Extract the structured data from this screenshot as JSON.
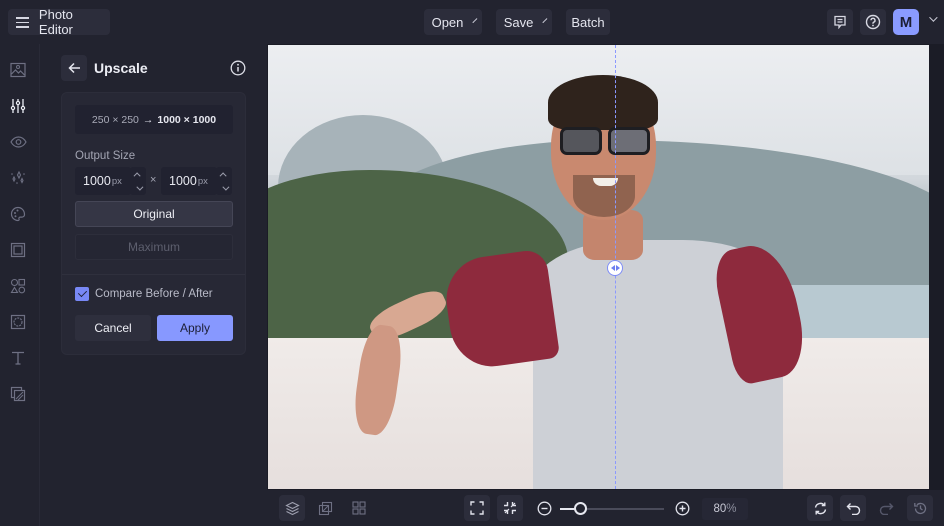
{
  "app": {
    "title": "Photo Editor",
    "menu_icon": "hamburger-icon"
  },
  "topbar": {
    "open_label": "Open",
    "save_label": "Save",
    "batch_label": "Batch",
    "feedback_icon": "comment-icon",
    "help_icon": "help-icon",
    "avatar_initial": "M",
    "accent_color": "#8a9bff"
  },
  "rail": {
    "items": [
      {
        "name": "image",
        "icon": "image-icon",
        "active": false
      },
      {
        "name": "adjust",
        "icon": "sliders-icon",
        "active": true
      },
      {
        "name": "view",
        "icon": "eye-icon",
        "active": false
      },
      {
        "name": "effects",
        "icon": "sparkles-icon",
        "active": false
      },
      {
        "name": "artsy",
        "icon": "palette-icon",
        "active": false
      },
      {
        "name": "frames",
        "icon": "frame-icon",
        "active": false
      },
      {
        "name": "graphics",
        "icon": "shapes-icon",
        "active": false
      },
      {
        "name": "overlays",
        "icon": "overlay-icon",
        "active": false
      },
      {
        "name": "text",
        "icon": "text-icon",
        "active": false
      },
      {
        "name": "textures",
        "icon": "texture-icon",
        "active": false
      }
    ]
  },
  "panel": {
    "title": "Upscale",
    "source_size": "250 × 250",
    "arrow": "→",
    "target_size": "1000 × 1000",
    "output_size_label": "Output Size",
    "width_value": "1000",
    "height_value": "1000",
    "unit": "px",
    "times": "×",
    "preset_original": "Original",
    "preset_maximum": "Maximum",
    "compare_label": "Compare Before / After",
    "compare_checked": true,
    "cancel_label": "Cancel",
    "apply_label": "Apply"
  },
  "canvas": {
    "compare_position": 0.525
  },
  "bottombar": {
    "zoom_value": "80",
    "zoom_unit": "%",
    "zoom_fraction": 0.2
  }
}
